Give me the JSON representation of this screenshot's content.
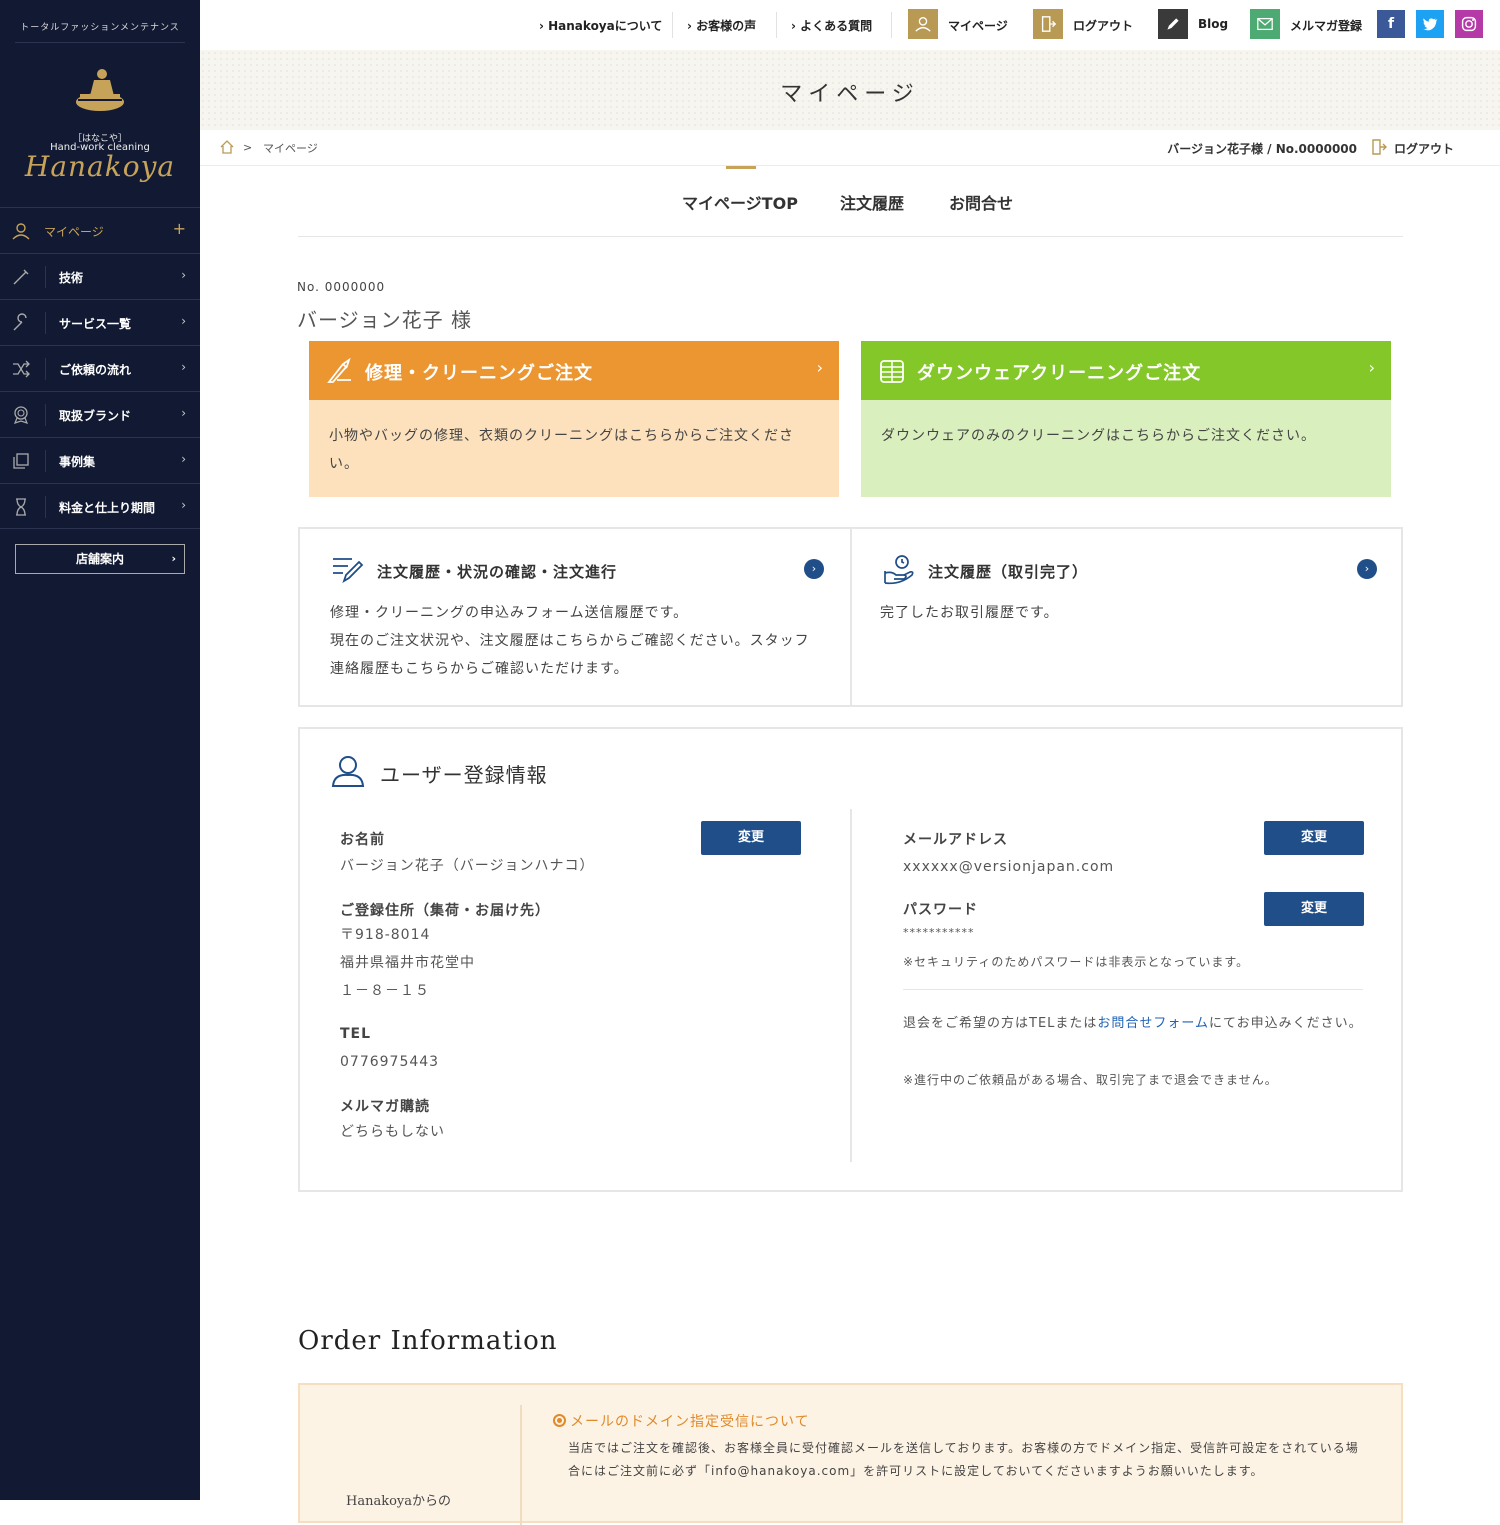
{
  "sidebar": {
    "tagline": "トータルファッションメンテナンス",
    "logo_sub": "［はなこや］",
    "logo_sub2": "Hand-work cleaning",
    "logo_text": "Hanakoya",
    "nav": [
      {
        "label": "マイページ",
        "icon": "user-icon",
        "arrow": "+"
      },
      {
        "label": "技術",
        "icon": "brush-icon",
        "arrow": "›"
      },
      {
        "label": "サービス一覧",
        "icon": "wrench-icon",
        "arrow": "›"
      },
      {
        "label": "ご依頼の流れ",
        "icon": "shuffle-icon",
        "arrow": "›"
      },
      {
        "label": "取扱ブランド",
        "icon": "badge-icon",
        "arrow": "›"
      },
      {
        "label": "事例集",
        "icon": "copy-icon",
        "arrow": "›"
      },
      {
        "label": "料金と仕上り期間",
        "icon": "hourglass-icon",
        "arrow": "›"
      }
    ],
    "store_label": "店舗案内",
    "store_arrow": "›"
  },
  "topbar": {
    "links": [
      "Hanakoyaについて",
      "お客様の声",
      "よくある質問"
    ],
    "mypage": "マイページ",
    "logout": "ログアウト",
    "blog": "Blog",
    "mail": "メルマガ登録",
    "facebook": "f",
    "colors": {
      "gold": "#b99a55",
      "blog": "#3a3a3a",
      "mail": "#4caa72",
      "facebook": "#3b5998",
      "twitter": "#1da1f2",
      "instagram": "#b53aa8"
    }
  },
  "hero": {
    "title": "マイページ"
  },
  "breadcrumb": {
    "separator": ">",
    "current": "マイページ",
    "user": "バージョン花子様 / No.0000000",
    "logout": "ログアウト"
  },
  "tabs": [
    "マイページTOP",
    "注文履歴",
    "お問合せ"
  ],
  "member": {
    "number": "No. 0000000",
    "name": "バージョン花子 様"
  },
  "orders": [
    {
      "title": "修理・クリーニングご注文",
      "body": "小物やバッグの修理、衣類のクリーニングはこちらからご注文ください。",
      "color": "#ec9632"
    },
    {
      "title": "ダウンウェアクリーニングご注文",
      "body": "ダウンウェアのみのクリーニングはこちらからご注文ください。",
      "color": "#84c728"
    }
  ],
  "history": [
    {
      "title": "注文履歴・状況の確認・注文進行",
      "line1": "修理・クリーニングの申込みフォーム送信履歴です。",
      "line2": "現在のご注文状況や、注文履歴はこちらからご確認ください。スタッフ連絡履歴もこちらからご確認いただけます。"
    },
    {
      "title": "注文履歴（取引完了）",
      "line1": "完了したお取引履歴です。"
    }
  ],
  "registration": {
    "title": "ユーザー登録情報",
    "change_label": "変更",
    "name_label": "お名前",
    "name_value": "バージョン花子（バージョンハナコ）",
    "address_label": "ご登録住所（集荷・お届け先）",
    "postal": "〒918-8014",
    "address1": "福井県福井市花堂中",
    "address2": "１－８－１５",
    "tel_label": "TEL",
    "tel_value": "0776975443",
    "newsletter_label": "メルマガ購読",
    "newsletter_value": "どちらもしない",
    "email_label": "メールアドレス",
    "email_value": "xxxxxx@versionjapan.com",
    "password_label": "パスワード",
    "password_value": "***********",
    "password_note": "※セキュリティのためパスワードは非表示となっています。",
    "withdraw_pre": "退会をご希望の方はTELまたは",
    "withdraw_link": "お問合せフォーム",
    "withdraw_post": "にてお申込みください。",
    "withdraw_note": "※進行中のご依頼品がある場合、取引完了まで退会できません。"
  },
  "order_info": {
    "title": "Order Information",
    "left_label": "Hanakoyaからの",
    "notice_title": "メールのドメイン指定受信について",
    "notice_body": "当店ではご注文を確認後、お客様全員に受付確認メールを送信しております。お客様の方でドメイン指定、受信許可設定をされている場合にはご注文前に必ず「info@hanakoya.com」を許可リストに設定しておいてくださいますようお願いいたします。"
  }
}
